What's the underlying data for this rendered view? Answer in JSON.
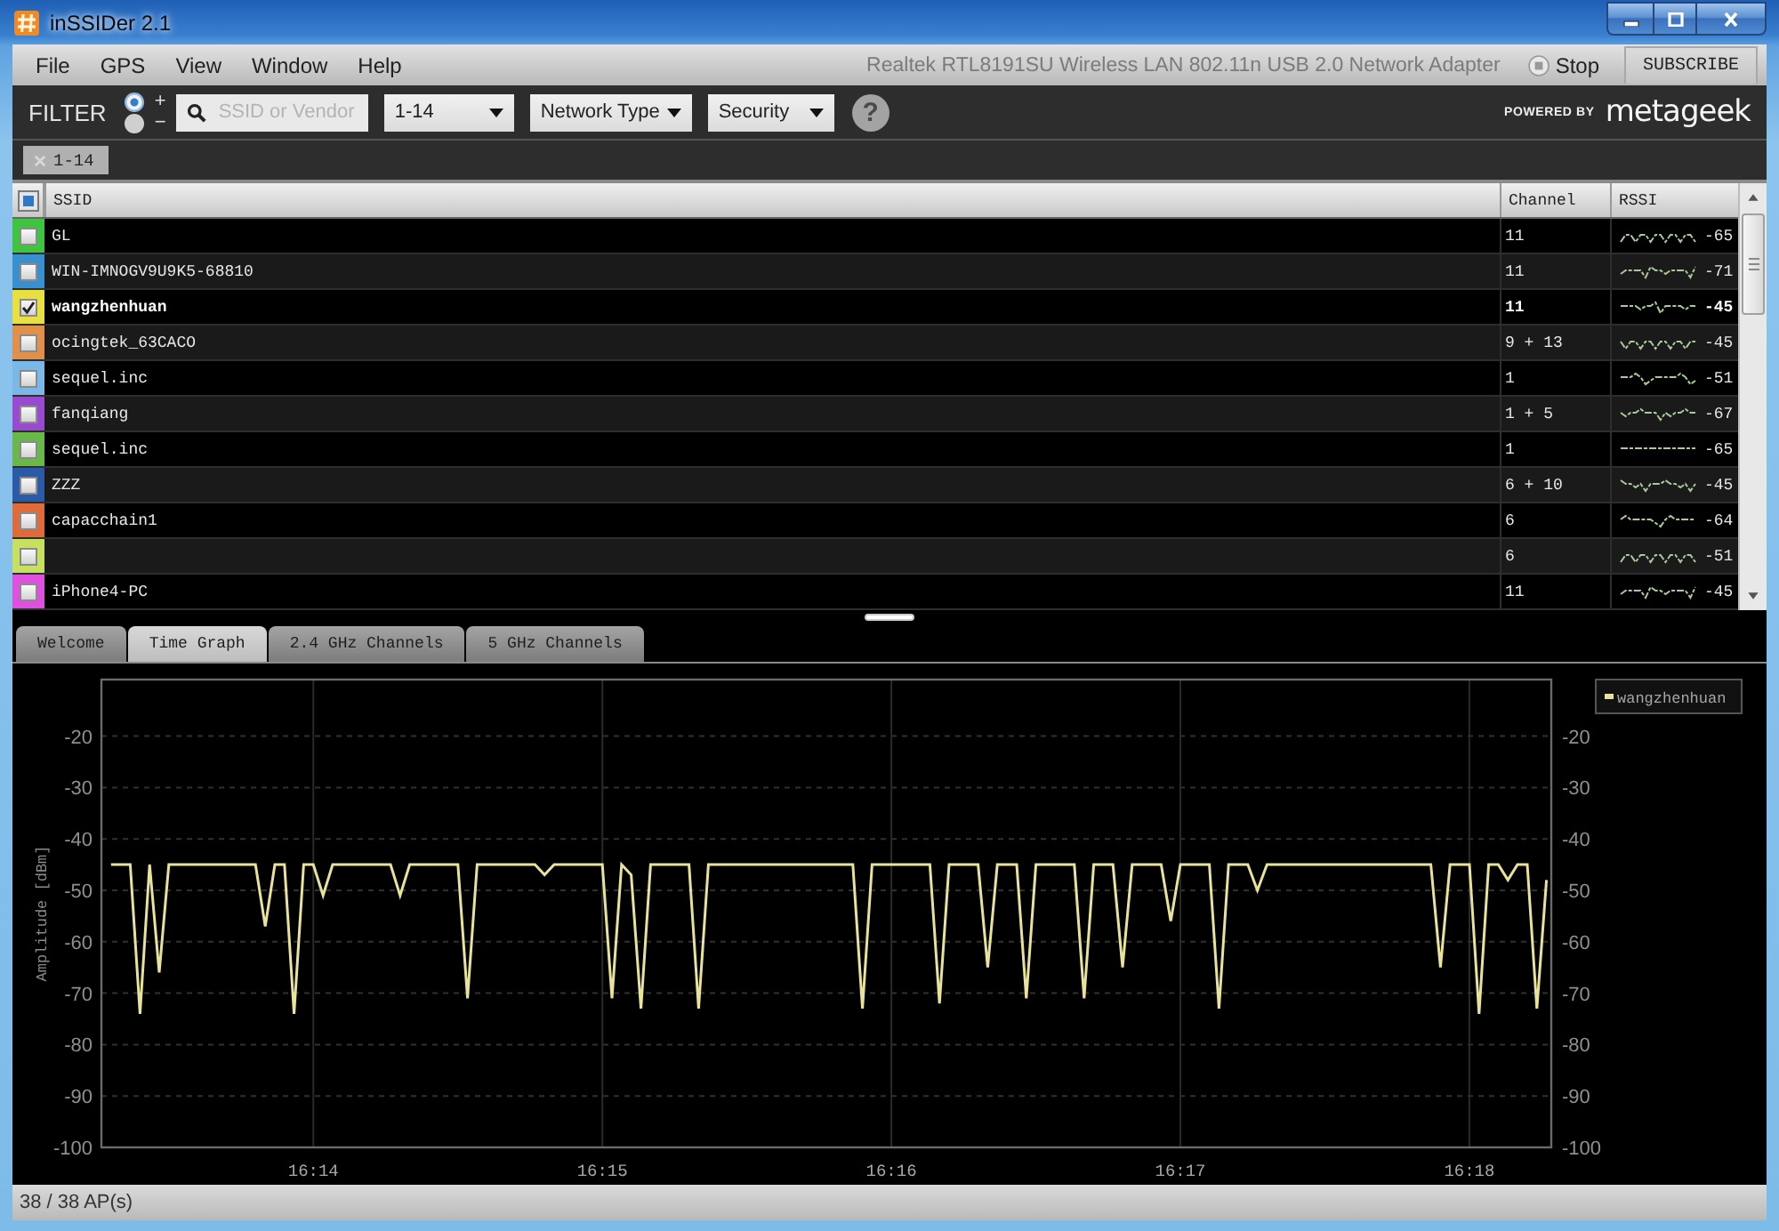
{
  "window": {
    "title": "inSSIDer 2.1"
  },
  "menu": [
    "File",
    "GPS",
    "View",
    "Window",
    "Help"
  ],
  "adapter": "Realtek RTL8191SU Wireless LAN 802.11n USB 2.0 Network Adapter",
  "stop_button": "Stop",
  "subscribe_button": "SUBSCRIBE",
  "filter": {
    "label": "FILTER",
    "modes": [
      {
        "label": "+",
        "selected": true
      },
      {
        "label": "−",
        "selected": false
      }
    ],
    "search": {
      "placeholder": "SSID or Vendor"
    },
    "dropdowns": [
      "1-14",
      "Network Type",
      "Security"
    ],
    "help": "?"
  },
  "brand": {
    "prefix": "POWERED BY",
    "name": "metageek"
  },
  "active_filters": [
    {
      "label": "1-14"
    }
  ],
  "table": {
    "partially_checked": true,
    "columns": [
      "SSID",
      "Channel",
      "RSSI"
    ],
    "rows": [
      {
        "color": "#3ec43e",
        "checked": false,
        "ssid": "GL",
        "channel": "11",
        "rssi": "-65"
      },
      {
        "color": "#3a8fd0",
        "checked": false,
        "ssid": "WIN-IMNOGV9U9K5-68810",
        "channel": "11",
        "rssi": "-71"
      },
      {
        "color": "#e8e040",
        "checked": true,
        "ssid": "wangzhenhuan",
        "channel": "11",
        "rssi": "-45"
      },
      {
        "color": "#e0904a",
        "checked": false,
        "ssid": "ocingtek_63CACO",
        "channel": "9 + 13",
        "rssi": "-45"
      },
      {
        "color": "#7ab8e8",
        "checked": false,
        "ssid": "sequel.inc",
        "channel": "1",
        "rssi": "-51"
      },
      {
        "color": "#9a4ad0",
        "checked": false,
        "ssid": "fanqiang",
        "channel": "1 + 5",
        "rssi": "-67"
      },
      {
        "color": "#6ab84a",
        "checked": false,
        "ssid": "sequel.inc",
        "channel": "1",
        "rssi": "-65"
      },
      {
        "color": "#2a5aa8",
        "checked": false,
        "ssid": "ZZZ",
        "channel": "6 + 10",
        "rssi": "-45"
      },
      {
        "color": "#e06a3a",
        "checked": false,
        "ssid": "capacchain1",
        "channel": "6",
        "rssi": "-64"
      },
      {
        "color": "#c8e060",
        "checked": false,
        "channel": "6",
        "rssi": "-51"
      },
      {
        "color": "#e050e0",
        "checked": false,
        "ssid": "iPhone4-PC",
        "channel": "11",
        "rssi": "-45"
      }
    ]
  },
  "tabs": [
    {
      "label": "Welcome",
      "selected": false
    },
    {
      "label": "Time Graph",
      "selected": true
    },
    {
      "label": "2.4 GHz Channels",
      "selected": false
    },
    {
      "label": "5 GHz Channels",
      "selected": false
    }
  ],
  "time_graph": {
    "chart_data": {
      "type": "line",
      "ylabel": "Amplitude [dBm]",
      "grid": true,
      "categories": [
        null,
        null,
        null,
        null,
        null,
        null,
        null,
        null,
        null,
        null,
        null,
        null,
        null,
        null,
        null,
        null,
        null,
        null,
        null,
        null,
        null,
        null,
        "16:14",
        null,
        null,
        null,
        null,
        null,
        null,
        null,
        null,
        null,
        null,
        null,
        null,
        null,
        null,
        null,
        null,
        null,
        null,
        null,
        null,
        null,
        null,
        null,
        null,
        null,
        null,
        null,
        null,
        null,
        "16:15",
        null,
        null,
        null,
        null,
        null,
        null,
        null,
        null,
        null,
        null,
        null,
        null,
        null,
        null,
        null,
        null,
        null,
        null,
        null,
        null,
        null,
        null,
        null,
        null,
        null,
        null,
        null,
        null,
        null,
        "16:16",
        null,
        null,
        null,
        null,
        null,
        null,
        null,
        null,
        null,
        null,
        null,
        null,
        null,
        null,
        null,
        null,
        null,
        null,
        null,
        null,
        null,
        null,
        null,
        null,
        null,
        null,
        null,
        null,
        null,
        "16:17",
        null,
        null,
        null,
        null,
        null,
        null,
        null,
        null,
        null,
        null,
        null,
        null,
        null,
        null,
        null,
        null,
        null,
        null,
        null,
        null,
        null,
        null,
        null,
        null,
        null,
        null,
        null,
        null,
        null,
        "16:18",
        null,
        null,
        null,
        null,
        null,
        null,
        null,
        null
      ],
      "series": [
        {
          "name": "wangzhenhuan",
          "color": "#e8e29a",
          "values": [
            null,
            -45,
            -45,
            -45,
            -74,
            -45,
            -66,
            -45,
            -45,
            -45,
            -45,
            -45,
            -45,
            -45,
            -45,
            -45,
            -45,
            -57,
            -45,
            -45,
            -74,
            -45,
            -45,
            -51,
            -45,
            -45,
            -45,
            -45,
            -45,
            -45,
            -45,
            -51,
            -45,
            -45,
            -45,
            -45,
            -45,
            -45,
            -71,
            -45,
            -45,
            -45,
            -45,
            -45,
            -45,
            -45,
            -47,
            -45,
            -45,
            -45,
            -45,
            -45,
            -45,
            -71,
            -45,
            -47,
            -73,
            -45,
            -45,
            -45,
            -45,
            -45,
            -73,
            -45,
            -45,
            -45,
            -45,
            -45,
            -45,
            -45,
            -45,
            -45,
            -45,
            -45,
            -45,
            -45,
            -45,
            -45,
            -45,
            -73,
            -45,
            -45,
            -45,
            -45,
            -45,
            -45,
            -45,
            -72,
            -45,
            -45,
            -45,
            -45,
            -65,
            -45,
            -45,
            -45,
            -71,
            -45,
            -45,
            -45,
            -45,
            -45,
            -71,
            -45,
            -45,
            -45,
            -65,
            -45,
            -45,
            -45,
            -45,
            -56,
            -45,
            -45,
            -45,
            -45,
            -73,
            -45,
            -45,
            -45,
            -50,
            -45,
            -45,
            -45,
            -45,
            -45,
            -45,
            -45,
            -45,
            -45,
            -45,
            -45,
            -45,
            -45,
            -45,
            -45,
            -45,
            -45,
            -45,
            -65,
            -45,
            -45,
            -45,
            -74,
            -45,
            -45,
            -48,
            -45,
            -45,
            -73,
            -48
          ]
        }
      ],
      "ylim": [
        -100,
        -9
      ],
      "y2lim": [
        -100,
        -9
      ],
      "yticks": [
        -20,
        -30,
        -40,
        -50,
        -60,
        -70,
        -80,
        -90,
        -100
      ],
      "y2ticks": [
        -20,
        -30,
        -40,
        -50,
        -60,
        -70,
        -80,
        -90,
        -100
      ]
    }
  },
  "status_bar": "38 / 38 AP(s)"
}
